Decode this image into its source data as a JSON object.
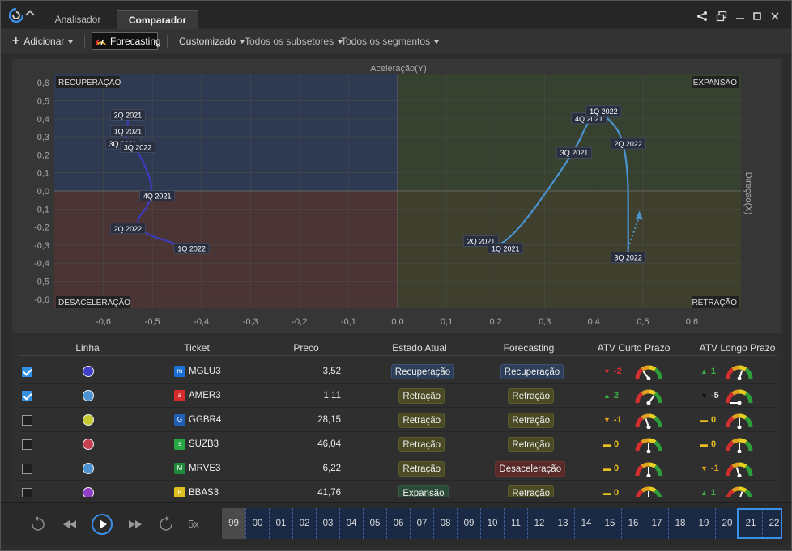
{
  "titlebar": {
    "tabs": [
      "Analisador",
      "Comparador"
    ],
    "active_tab": "Comparador"
  },
  "toolbar": {
    "add_label": "Adicionar",
    "forecasting_label": "Forecasting",
    "custom_label": "Customizado",
    "subsectors_label": "Todos os subsetores",
    "segments_label": "Todos os segmentos"
  },
  "chart": {
    "x_title": "Aceleração(Y)",
    "y_title": "Direção(X)",
    "quadrants": {
      "top_left": "RECUPERAÇÃO",
      "top_right": "EXPANSÃO",
      "bottom_left": "DESACELERAÇÃO",
      "bottom_right": "RETRAÇÃO"
    },
    "colors": {
      "recovery": "#2e3a52",
      "expansion": "#36412f",
      "decel": "#4a3434",
      "retract": "#3f3f2e",
      "series_a": "#3c3cc0",
      "series_b": "#4b93d1"
    }
  },
  "chart_data": {
    "type": "scatter",
    "xlim": [
      -0.7,
      0.7
    ],
    "ylim": [
      -0.65,
      0.65
    ],
    "x_ticks": [
      "-0,6",
      "-0,5",
      "-0,4",
      "-0,3",
      "-0,2",
      "-0,1",
      "0,0",
      "0,1",
      "0,2",
      "0,3",
      "0,4",
      "0,5",
      "0,6"
    ],
    "y_ticks": [
      "0,6",
      "0,5",
      "0,4",
      "0,3",
      "0,2",
      "0,1",
      "0,0",
      "-0,1",
      "-0,2",
      "-0,3",
      "-0,4",
      "-0,5",
      "-0,6"
    ],
    "series": [
      {
        "color": "#3c3cc0",
        "points": [
          {
            "label": "2Q 2021",
            "x": -0.55,
            "y": 0.42
          },
          {
            "label": "1Q 2021",
            "x": -0.55,
            "y": 0.33
          },
          {
            "label": "3Q 2021",
            "x": -0.56,
            "y": 0.26
          },
          {
            "label": "3Q 2022",
            "x": -0.53,
            "y": 0.24
          },
          {
            "label": "4Q 2021",
            "x": -0.49,
            "y": -0.03
          },
          {
            "label": "2Q 2022",
            "x": -0.55,
            "y": -0.21
          },
          {
            "label": "1Q 2022",
            "x": -0.42,
            "y": -0.32
          }
        ]
      },
      {
        "color": "#4b93d1",
        "points": [
          {
            "label": "2Q 2021",
            "x": 0.17,
            "y": -0.28
          },
          {
            "label": "1Q 2021",
            "x": 0.22,
            "y": -0.32
          },
          {
            "label": "3Q 2021",
            "x": 0.36,
            "y": 0.21
          },
          {
            "label": "4Q 2021",
            "x": 0.39,
            "y": 0.4
          },
          {
            "label": "1Q 2022",
            "x": 0.42,
            "y": 0.44
          },
          {
            "label": "2Q 2022",
            "x": 0.47,
            "y": 0.26
          },
          {
            "label": "3Q 2022",
            "x": 0.47,
            "y": -0.37
          }
        ]
      }
    ]
  },
  "table": {
    "headers": [
      "Linha",
      "Ticket",
      "Preco",
      "Estado Atual",
      "Forecasting",
      "ATV Curto Prazo",
      "ATV Longo Prazo"
    ],
    "rows": [
      {
        "checked": true,
        "color": "#4040c8",
        "ticker": "MGLU3",
        "icon_color": "#1a6fd8",
        "icon": "m",
        "price": "3,52",
        "estado": "Recuperação",
        "forecast": "Recuperação",
        "curto": "-2",
        "curto_dir": "down",
        "longo": "1",
        "longo_dir": "up"
      },
      {
        "checked": true,
        "color": "#4b93d1",
        "ticker": "AMER3",
        "icon_color": "#d62b2b",
        "icon": "a",
        "price": "1,11",
        "estado": "Retração",
        "forecast": "Retração",
        "curto": "2",
        "curto_dir": "up",
        "longo": "-5",
        "longo_dir": "down-black"
      },
      {
        "checked": false,
        "color": "#c8c830",
        "ticker": "GGBR4",
        "icon_color": "#1f5fb5",
        "icon": "G",
        "price": "28,15",
        "estado": "Retração",
        "forecast": "Retração",
        "curto": "-1",
        "curto_dir": "down-yellow",
        "longo": "0",
        "longo_dir": "flat"
      },
      {
        "checked": false,
        "color": "#c84050",
        "ticker": "SUZB3",
        "icon_color": "#27a844",
        "icon": "s",
        "price": "46,04",
        "estado": "Retração",
        "forecast": "Retração",
        "curto": "0",
        "curto_dir": "flat",
        "longo": "0",
        "longo_dir": "flat"
      },
      {
        "checked": false,
        "color": "#4b93d1",
        "ticker": "MRVE3",
        "icon_color": "#1f8a3a",
        "icon": "M",
        "price": "6,22",
        "estado": "Retração",
        "forecast": "Desaceleração",
        "curto": "0",
        "curto_dir": "flat",
        "longo": "-1",
        "longo_dir": "down-yellow"
      },
      {
        "checked": false,
        "color": "#9040c8",
        "ticker": "BBAS3",
        "icon_color": "#e0c020",
        "icon": "B",
        "price": "41,76",
        "estado": "Expansão",
        "forecast": "Retração",
        "curto": "0",
        "curto_dir": "flat",
        "longo": "1",
        "longo_dir": "up"
      }
    ]
  },
  "playbar": {
    "speed": "5x",
    "years": [
      "99",
      "00",
      "01",
      "02",
      "03",
      "04",
      "05",
      "06",
      "07",
      "08",
      "09",
      "10",
      "11",
      "12",
      "13",
      "14",
      "15",
      "16",
      "17",
      "18",
      "19",
      "20",
      "21",
      "22"
    ]
  }
}
